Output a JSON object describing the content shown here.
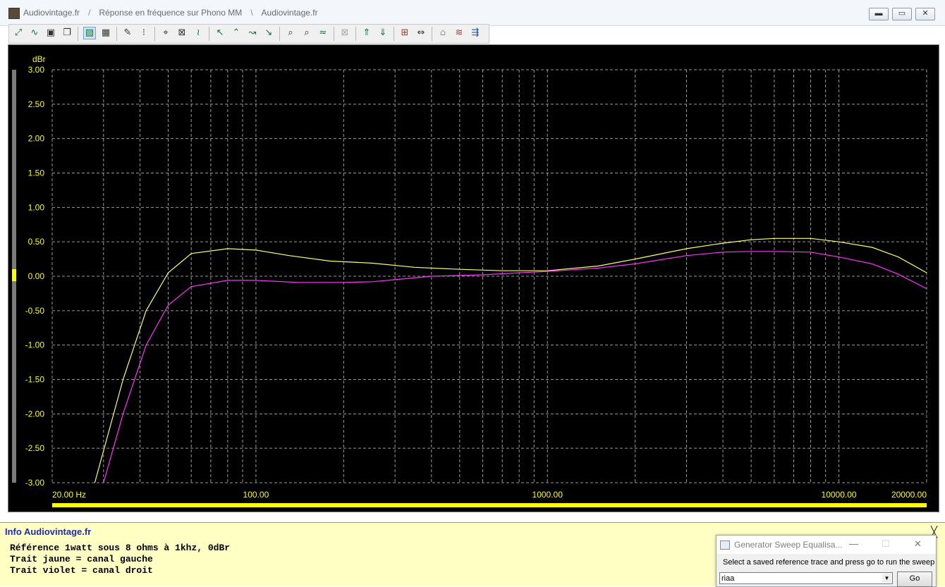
{
  "window": {
    "breadcrumb": [
      "Audiovintage.fr",
      "Réponse en fréquence sur Phono MM",
      "Audiovintage.fr"
    ],
    "separators": [
      "/",
      "\\"
    ],
    "controls": {
      "minimize": "▬",
      "restore": "▭",
      "close": "✕"
    }
  },
  "toolbar": {
    "icons": [
      "add-trace-icon",
      "wave-icon",
      "save-icon",
      "copy-icon",
      "graph-mode-icon",
      "graph-settings-icon",
      "edit-icon",
      "data-table-icon",
      "zoom-fit-icon",
      "zoom-x-icon",
      "trace-icon",
      "cursor-left-icon",
      "cursor-peak-icon",
      "cursor-a-icon",
      "cursor-b-icon",
      "marker-a-icon",
      "marker-b-icon",
      "marker-line-icon",
      "disabled-marker-icon",
      "step-up-icon",
      "step-down-icon",
      "level-meter-icon",
      "expand-icon",
      "baseline-icon",
      "reference-icon",
      "sweep-settings-icon"
    ]
  },
  "chart_data": {
    "type": "line",
    "ylabel": "dBr",
    "x_scale": "log",
    "xlim": [
      20,
      20000
    ],
    "ylim": [
      -3,
      3
    ],
    "y_ticks": [
      "3.00",
      "2.50",
      "2.00",
      "1.50",
      "1.00",
      "0.50",
      "0.00",
      "-0.50",
      "-1.00",
      "-1.50",
      "-2.00",
      "-2.50",
      "-3.00"
    ],
    "x_tick_labels": [
      {
        "value": 20,
        "label": "20.00 Hz"
      },
      {
        "value": 100,
        "label": "100.00"
      },
      {
        "value": 1000,
        "label": "1000.00"
      },
      {
        "value": 10000,
        "label": "10000.00"
      },
      {
        "value": 20000,
        "label": "20000.00"
      }
    ],
    "grid": true,
    "series": [
      {
        "color": "#ffff66",
        "x": [
          28,
          35,
          42,
          50,
          60,
          80,
          100,
          130,
          180,
          250,
          350,
          500,
          700,
          1000,
          1500,
          2000,
          3000,
          4000,
          5000,
          6000,
          8000,
          10000,
          13000,
          16000,
          20000
        ],
        "y": [
          -3.0,
          -1.5,
          -0.5,
          0.05,
          0.33,
          0.4,
          0.38,
          0.3,
          0.22,
          0.19,
          0.13,
          0.1,
          0.08,
          0.08,
          0.15,
          0.25,
          0.4,
          0.48,
          0.53,
          0.55,
          0.55,
          0.5,
          0.42,
          0.28,
          0.05
        ]
      },
      {
        "color": "#ff33ff",
        "x": [
          30,
          35,
          42,
          50,
          60,
          80,
          100,
          140,
          200,
          250,
          300,
          400,
          600,
          800,
          1000,
          1500,
          2000,
          3000,
          4000,
          5000,
          6000,
          8000,
          10000,
          13000,
          16000,
          20000
        ],
        "y": [
          -3.0,
          -2.0,
          -1.0,
          -0.42,
          -0.15,
          -0.06,
          -0.06,
          -0.09,
          -0.09,
          -0.08,
          -0.05,
          0.0,
          0.02,
          0.05,
          0.07,
          0.12,
          0.18,
          0.3,
          0.35,
          0.36,
          0.36,
          0.35,
          0.28,
          0.18,
          0.03,
          -0.18
        ]
      }
    ]
  },
  "info_panel": {
    "title": "Info Audiovintage.fr",
    "lines": [
      "Référence 1watt sous 8 ohms à 1khz, 0dBr",
      "Trait jaune = canal gauche",
      "Trait violet = canal droit"
    ],
    "close": "╳"
  },
  "generator_dialog": {
    "title": "Generator Sweep Equalisa...",
    "message": "Select a saved reference trace and press go to run the sweep",
    "selected": "riaa",
    "go_label": "Go",
    "controls": {
      "minimize": "—",
      "maximize": "☐",
      "close": "✕"
    }
  }
}
